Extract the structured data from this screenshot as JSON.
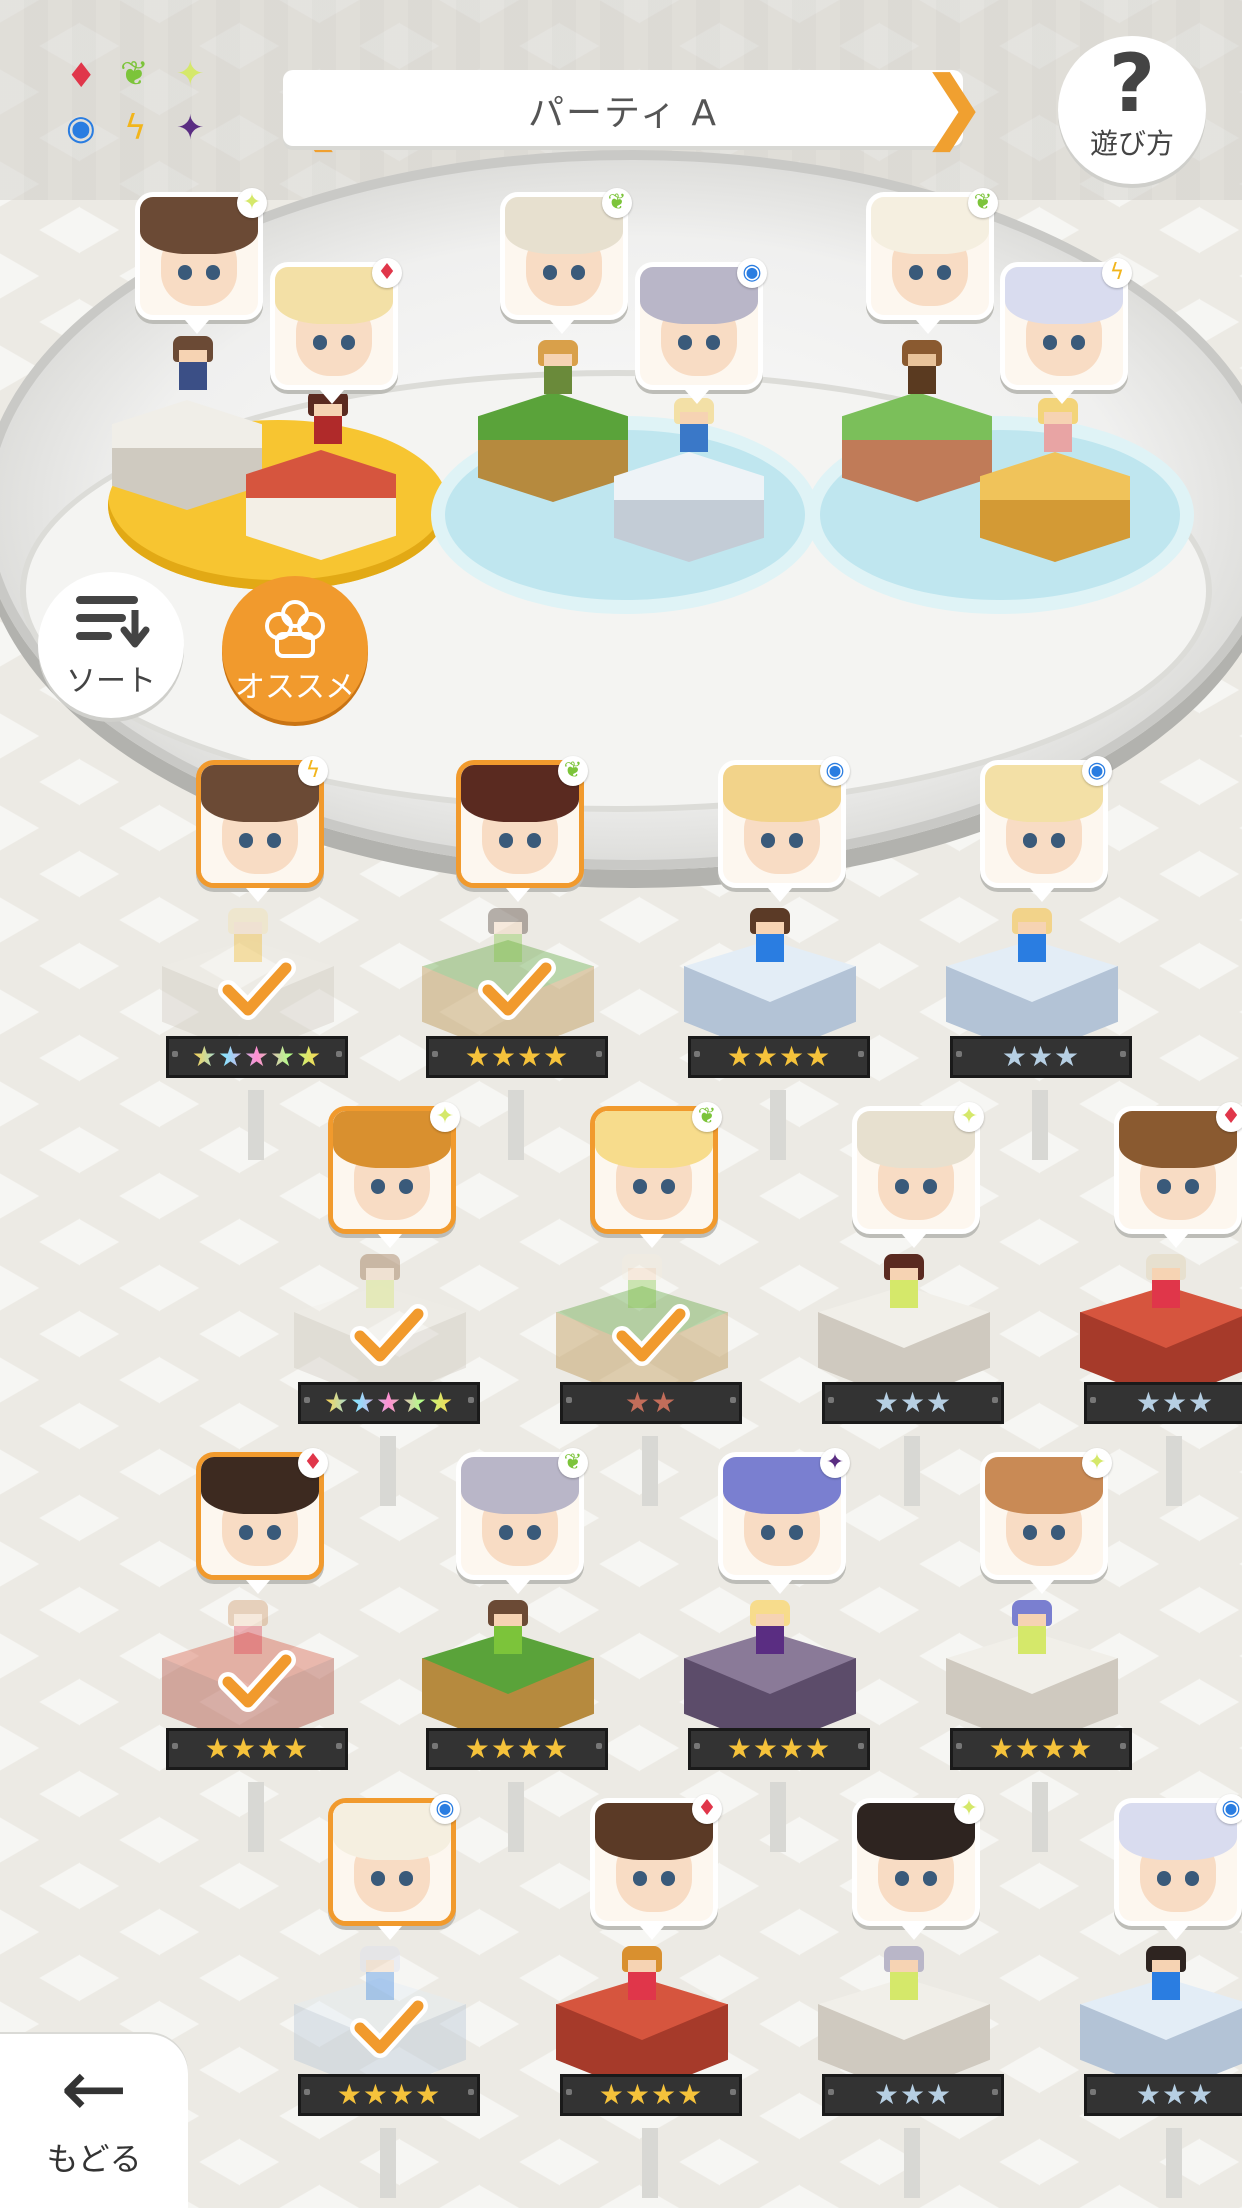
{
  "header": {
    "party_title": "パーティ A",
    "prev_arrow": "❮",
    "next_arrow": "❯"
  },
  "help": {
    "symbol": "?",
    "label": "遊び方"
  },
  "sort": {
    "label": "ソート"
  },
  "recommend": {
    "label": "オススメ"
  },
  "back": {
    "symbol": "←",
    "label": "もどる"
  },
  "elements_legend": [
    "fire",
    "leaf",
    "light",
    "water",
    "thunder",
    "dark"
  ],
  "colors": {
    "accent": "#f19a2d",
    "fire": "#e0364a",
    "leaf": "#7cc43a",
    "light": "#d5e86a",
    "water": "#2a7de1",
    "thunder": "#f2b51c",
    "dark": "#5a2d82"
  },
  "party_slots": [
    {
      "element": "light",
      "platform": "stone"
    },
    {
      "element": "fire",
      "platform": "red"
    },
    {
      "element": "leaf",
      "platform": "grass"
    },
    {
      "element": "water",
      "platform": "ice"
    },
    {
      "element": "leaf",
      "platform": "dirt"
    },
    {
      "element": "thunder",
      "platform": "sand"
    }
  ],
  "roster": [
    {
      "element": "thunder",
      "stars": "★★★★★",
      "rarity": "rainbow",
      "selected": true
    },
    {
      "element": "leaf",
      "stars": "★★★★",
      "rarity": "gold",
      "selected": true
    },
    {
      "element": "water",
      "stars": "★★★★",
      "rarity": "gold",
      "selected": false
    },
    {
      "element": "water",
      "stars": "★★★",
      "rarity": "silver",
      "selected": false
    },
    {
      "element": "light",
      "stars": "★★★★★",
      "rarity": "rainbow",
      "selected": true
    },
    {
      "element": "leaf",
      "stars": "★★",
      "rarity": "bronze",
      "selected": true
    },
    {
      "element": "light",
      "stars": "★★★",
      "rarity": "silver",
      "selected": false
    },
    {
      "element": "fire",
      "stars": "★★★",
      "rarity": "silver",
      "selected": false
    },
    {
      "element": "fire",
      "stars": "★★★★",
      "rarity": "gold",
      "selected": true
    },
    {
      "element": "leaf",
      "stars": "★★★★",
      "rarity": "gold",
      "selected": false
    },
    {
      "element": "dark",
      "stars": "★★★★",
      "rarity": "gold",
      "selected": false
    },
    {
      "element": "light",
      "stars": "★★★★",
      "rarity": "gold",
      "selected": false
    },
    {
      "element": "water",
      "stars": "★★★★",
      "rarity": "gold",
      "selected": true
    },
    {
      "element": "fire",
      "stars": "★★★★",
      "rarity": "gold",
      "selected": false
    },
    {
      "element": "light",
      "stars": "★★★",
      "rarity": "silver",
      "selected": false
    },
    {
      "element": "water",
      "stars": "★★★",
      "rarity": "silver",
      "selected": false
    }
  ]
}
